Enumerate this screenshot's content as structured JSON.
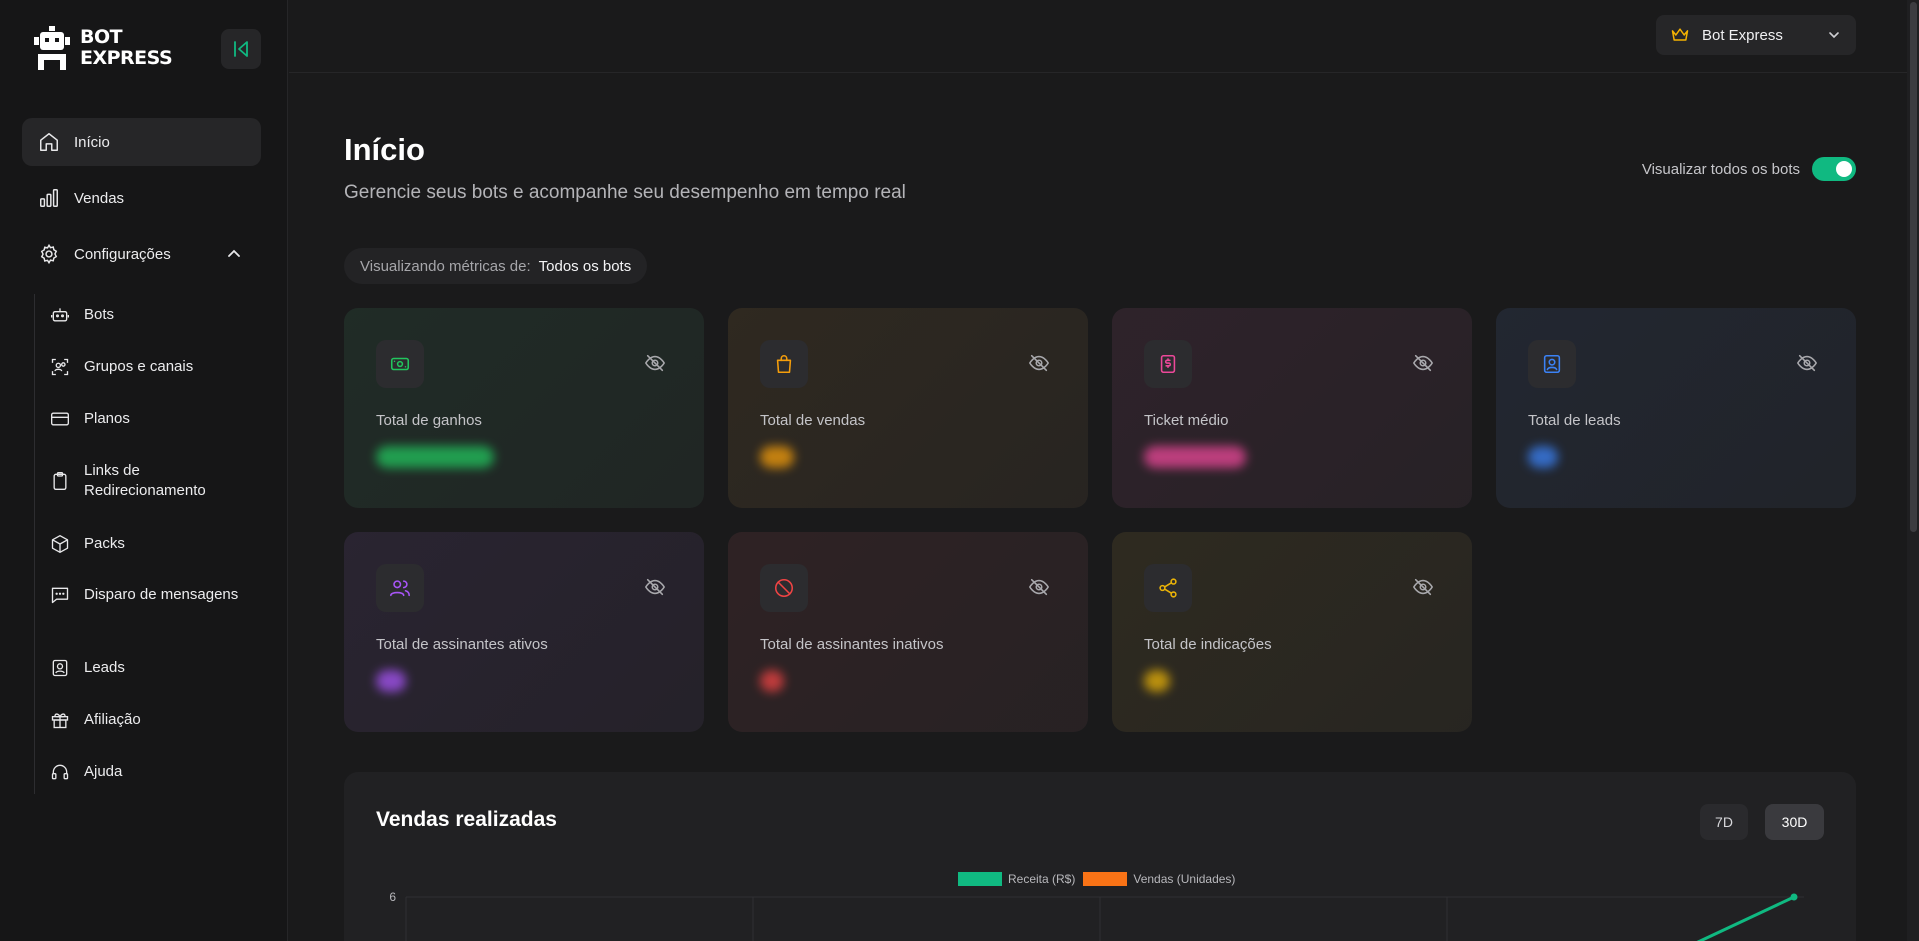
{
  "brand": {
    "line1": "BOT",
    "line2": "EXPRESS"
  },
  "sidebar": {
    "main_items": [
      {
        "label": "Início",
        "icon": "home-icon"
      },
      {
        "label": "Vendas",
        "icon": "bar-chart-icon"
      },
      {
        "label": "Configurações",
        "icon": "gear-icon"
      }
    ],
    "sub_items": [
      {
        "label": "Bots",
        "icon": "robot-icon"
      },
      {
        "label": "Grupos e canais",
        "icon": "group-icon"
      },
      {
        "label": "Planos",
        "icon": "credit-card-icon"
      },
      {
        "label": "Links de Redirecionamento",
        "icon": "clipboard-icon"
      },
      {
        "label": "Packs",
        "icon": "package-icon"
      },
      {
        "label": "Disparo de mensagens",
        "icon": "message-icon"
      },
      {
        "label": "Leads",
        "icon": "contact-icon"
      },
      {
        "label": "Afiliação",
        "icon": "gift-icon"
      },
      {
        "label": "Ajuda",
        "icon": "headset-icon"
      }
    ]
  },
  "header": {
    "bot_select": "Bot Express"
  },
  "main": {
    "title": "Início",
    "subtitle": "Gerencie seus bots e acompanhe seu desempenho em tempo real",
    "toggle_label": "Visualizar todos os bots",
    "toggle_on": true,
    "metrics_label": "Visualizando métricas de:",
    "metrics_value": "Todos os bots"
  },
  "cards": [
    {
      "label": "Total de ganhos",
      "icon": "money-icon",
      "accent": "#22c55e"
    },
    {
      "label": "Total de vendas",
      "icon": "shopping-bag-icon",
      "accent": "#f59e0b"
    },
    {
      "label": "Ticket médio",
      "icon": "receipt-icon",
      "accent": "#ec4899"
    },
    {
      "label": "Total de leads",
      "icon": "contact-icon",
      "accent": "#3b82f6"
    },
    {
      "label": "Total de assinantes ativos",
      "icon": "users-icon",
      "accent": "#a855f7"
    },
    {
      "label": "Total de assinantes inativos",
      "icon": "ban-icon",
      "accent": "#ef4444"
    },
    {
      "label": "Total de indicações",
      "icon": "share-icon",
      "accent": "#eab308"
    }
  ],
  "sales": {
    "title": "Vendas realizadas",
    "ranges": [
      "7D",
      "30D"
    ],
    "active_range": "30D"
  },
  "chart_data": {
    "type": "line",
    "series": [
      {
        "name": "Receita (R$)",
        "color": "#10b981"
      },
      {
        "name": "Vendas (Unidades)",
        "color": "#f97316"
      }
    ],
    "y_ticks": [
      "6"
    ],
    "grid": true
  }
}
